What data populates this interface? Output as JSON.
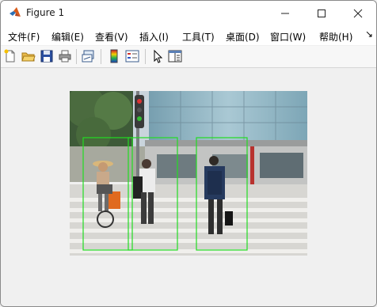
{
  "window": {
    "title": "Figure 1",
    "icons": [
      "matlab-logo-icon",
      "minimize-icon",
      "maximize-icon",
      "close-icon"
    ]
  },
  "menu": {
    "items": [
      "文件(F)",
      "编辑(E)",
      "查看(V)",
      "插入(I)",
      "工具(T)",
      "桌面(D)",
      "窗口(W)",
      "帮助(H)"
    ],
    "overflow_icon": "chevron-arrow-icon"
  },
  "toolbar": {
    "buttons": [
      "new-figure-icon",
      "open-file-icon",
      "save-icon",
      "print-icon",
      "link-plot-icon",
      "colorbar-icon",
      "legend-icon",
      "edit-plot-arrow-icon",
      "property-inspector-icon"
    ]
  },
  "figure": {
    "content": "street-photo-with-detections",
    "box_color": "#22dd22",
    "detections": 3
  }
}
